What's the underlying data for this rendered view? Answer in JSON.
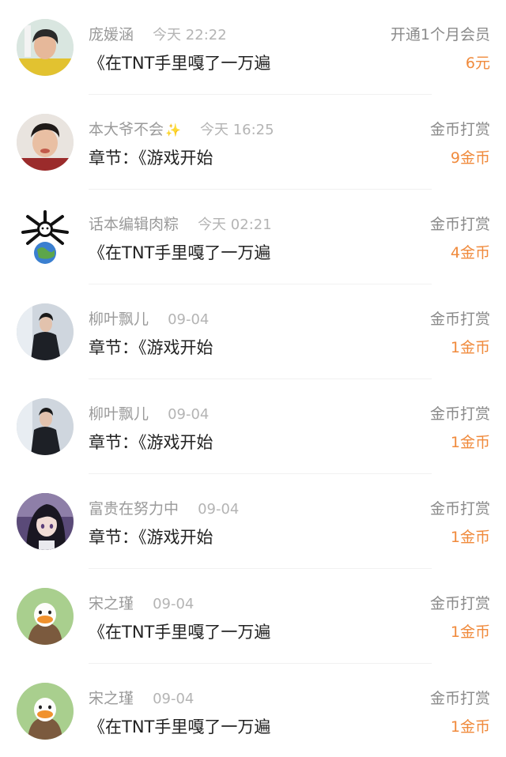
{
  "colors": {
    "accent_amount": "#f08a3c",
    "name_gray": "#9a9a9a",
    "time_gray": "#b4b4b4",
    "content_text": "#222222",
    "divider": "#f1f1f1"
  },
  "items": [
    {
      "avatar": "photo-avatar-boy-yellow-shirt",
      "name": "庞媛涵",
      "badge": "",
      "time": "今天 22:22",
      "content": "《在TNT手里嘎了一万遍",
      "action": "开通1个月会员",
      "amount": "6元"
    },
    {
      "avatar": "photo-avatar-boy-red-shirt",
      "name": "本大爷不会",
      "badge": "sparkle-icon",
      "time": "今天 16:25",
      "content": "章节：《游戏开始",
      "action": "金币打赏",
      "amount": "9金币"
    },
    {
      "avatar": "cartoon-avatar-earth-figure",
      "name": "话本编辑肉粽",
      "badge": "",
      "time": "今天 02:21",
      "content": "《在TNT手里嘎了一万遍",
      "action": "金币打赏",
      "amount": "4金币"
    },
    {
      "avatar": "photo-avatar-man-dark-jacket",
      "name": "柳叶飘儿",
      "badge": "",
      "time": "09-04",
      "content": "章节：《游戏开始",
      "action": "金币打赏",
      "amount": "1金币"
    },
    {
      "avatar": "photo-avatar-man-dark-jacket",
      "name": "柳叶飘儿",
      "badge": "",
      "time": "09-04",
      "content": "章节：《游戏开始",
      "action": "金币打赏",
      "amount": "1金币"
    },
    {
      "avatar": "anime-avatar-dark-hair-girl",
      "name": "富贵在努力中",
      "badge": "",
      "time": "09-04",
      "content": "章节：《游戏开始",
      "action": "金币打赏",
      "amount": "1金币"
    },
    {
      "avatar": "cartoon-avatar-duck",
      "name": "宋之瑾",
      "badge": "",
      "time": "09-04",
      "content": "《在TNT手里嘎了一万遍",
      "action": "金币打赏",
      "amount": "1金币"
    },
    {
      "avatar": "cartoon-avatar-duck",
      "name": "宋之瑾",
      "badge": "",
      "time": "09-04",
      "content": "《在TNT手里嘎了一万遍",
      "action": "金币打赏",
      "amount": "1金币"
    }
  ]
}
